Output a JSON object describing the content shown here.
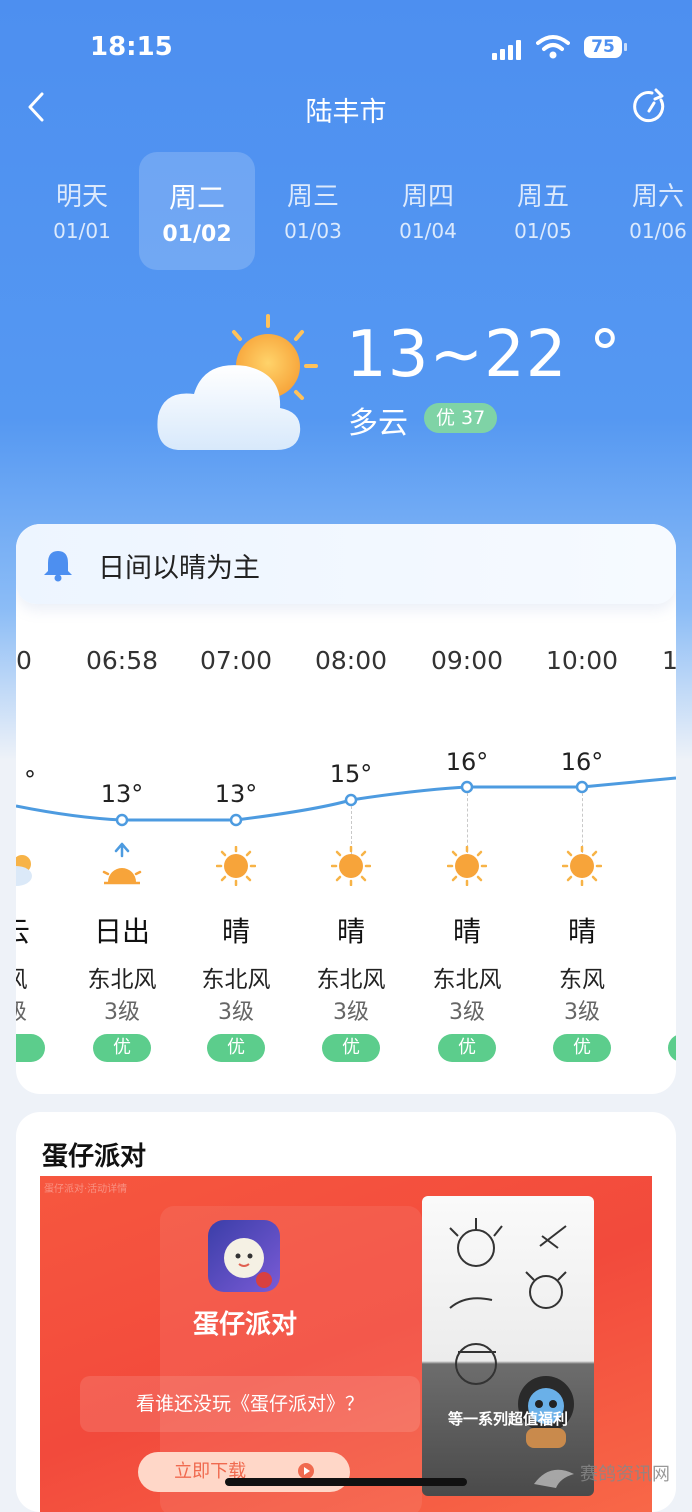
{
  "status_bar": {
    "time": "18:15",
    "battery": "75"
  },
  "header": {
    "city": "陆丰市"
  },
  "days": [
    {
      "name": "明天",
      "date": "01/01",
      "selected": false
    },
    {
      "name": "周二",
      "date": "01/02",
      "selected": true
    },
    {
      "name": "周三",
      "date": "01/03",
      "selected": false
    },
    {
      "name": "周四",
      "date": "01/04",
      "selected": false
    },
    {
      "name": "周五",
      "date": "01/05",
      "selected": false
    },
    {
      "name": "周六",
      "date": "01/06",
      "selected": false
    }
  ],
  "today": {
    "temp_range": "13~22 °",
    "condition": "多云",
    "aqi": "优 37"
  },
  "summary": {
    "text": "日间以晴为主"
  },
  "hourly": [
    {
      "time": "00",
      "temp": "°",
      "weather": "云",
      "wind": "风",
      "level": "级",
      "aqi": "",
      "icon": "cloud-sun-icon"
    },
    {
      "time": "06:58",
      "temp": "13°",
      "weather": "日出",
      "wind": "东北风",
      "level": "3级",
      "aqi": "优",
      "icon": "sunrise-icon"
    },
    {
      "time": "07:00",
      "temp": "13°",
      "weather": "晴",
      "wind": "东北风",
      "level": "3级",
      "aqi": "优",
      "icon": "sun-icon"
    },
    {
      "time": "08:00",
      "temp": "15°",
      "weather": "晴",
      "wind": "东北风",
      "level": "3级",
      "aqi": "优",
      "icon": "sun-icon"
    },
    {
      "time": "09:00",
      "temp": "16°",
      "weather": "晴",
      "wind": "东北风",
      "level": "3级",
      "aqi": "优",
      "icon": "sun-icon"
    },
    {
      "time": "10:00",
      "temp": "16°",
      "weather": "晴",
      "wind": "东风",
      "level": "3级",
      "aqi": "优",
      "icon": "sun-icon"
    },
    {
      "time": "1",
      "temp": "",
      "weather": "",
      "wind": "",
      "level": "",
      "aqi": "",
      "icon": ""
    }
  ],
  "ad": {
    "title": "蛋仔派对",
    "app_name": "蛋仔派对",
    "question": "看谁还没玩《蛋仔派对》？",
    "download": "立即下载",
    "photo_caption": "等一系列超值福利",
    "fine_print": "蛋仔派对·活动详情"
  },
  "watermark": {
    "text": "赛鸽资讯网"
  },
  "colors": {
    "sky": "#4d8ff0",
    "aqi_green": "#5ccd8c",
    "ad_red": "#f24a3c",
    "curve": "#4d9be0"
  }
}
